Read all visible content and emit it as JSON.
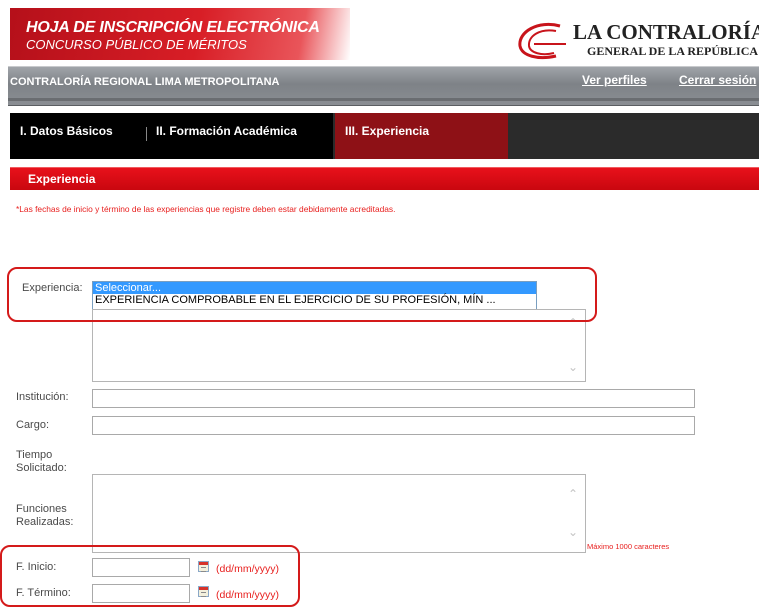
{
  "header": {
    "title": "HOJA DE INSCRIPCIÓN ELECTRÓNICA",
    "subtitle": "CONCURSO PÚBLICO DE MÉRITOS",
    "logo_name": "LA CONTRALORÍA",
    "logo_sub": "GENERAL DE LA REPÚBLICA"
  },
  "topbar": {
    "region": "CONTRALORÍA REGIONAL LIMA METROPOLITANA",
    "ver_perfiles": "Ver perfiles",
    "cerrar_sesion": "Cerrar sesión"
  },
  "tabs": [
    {
      "label": "I. Datos Básicos",
      "active": false
    },
    {
      "label": "II. Formación Académica",
      "active": false
    },
    {
      "label": "III. Experiencia",
      "active": true
    }
  ],
  "section": {
    "title": "Experiencia",
    "note": "*Las fechas de inicio y término de las experiencias que registre deben estar debidamente acreditadas."
  },
  "form": {
    "experiencia_label": "Experiencia:",
    "experiencia_options": [
      "Seleccionar...",
      "EXPERIENCIA COMPROBABLE EN EL EJERCICIO DE SU PROFESIÓN, MÍN ..."
    ],
    "experiencia_selected": "Seleccionar...",
    "institucion_label": "Institución:",
    "institucion_value": "",
    "cargo_label": "Cargo:",
    "cargo_value": "",
    "tiempo_label_1": "Tiempo",
    "tiempo_label_2": "Solicitado:",
    "funciones_label_1": "Funciones",
    "funciones_label_2": "Realizadas:",
    "funciones_value": "",
    "funciones_hint": "Máximo 1000 caracteres",
    "f_inicio_label": "F. Inicio:",
    "f_inicio_value": "",
    "f_termino_label": "F. Término:",
    "f_termino_value": "",
    "date_format": "(dd/mm/yyyy)"
  },
  "colors": {
    "brand_red": "#d81e26",
    "active_tab": "#8e1116",
    "highlight": "#d41a1a"
  }
}
